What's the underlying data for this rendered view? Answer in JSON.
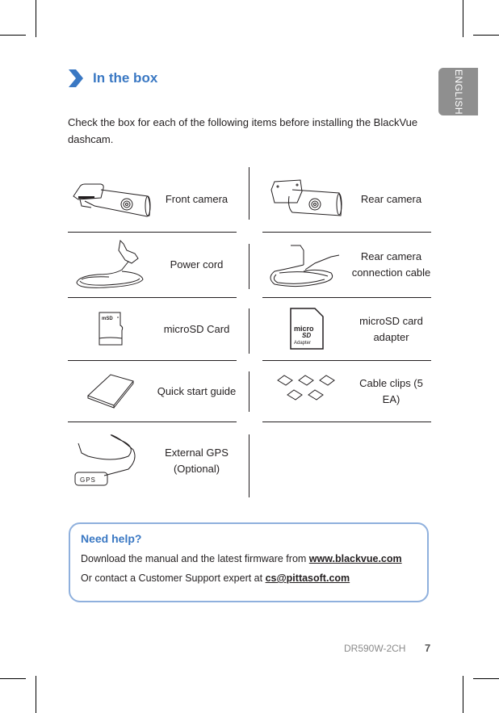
{
  "language_tab": "ENGLISH",
  "section": {
    "title": "In the box",
    "intro": "Check the box for each of the following items before installing the BlackVue dashcam."
  },
  "items": [
    {
      "label": "Front camera",
      "icon": "front-camera-icon"
    },
    {
      "label": "Rear camera",
      "icon": "rear-camera-icon"
    },
    {
      "label": "Power cord",
      "icon": "power-cord-icon"
    },
    {
      "label": "Rear camera connection cable",
      "icon": "connection-cable-icon"
    },
    {
      "label": "microSD Card",
      "icon": "microsd-card-icon"
    },
    {
      "label": "microSD card adapter",
      "icon": "sd-adapter-icon"
    },
    {
      "label": "Quick start guide",
      "icon": "quick-start-guide-icon"
    },
    {
      "label": "Cable clips (5 EA)",
      "icon": "cable-clips-icon"
    },
    {
      "label": "External GPS (Optional)",
      "icon": "external-gps-icon"
    }
  ],
  "icon_text": {
    "sd_adapter_micro": "micro",
    "sd_adapter_sd": "SD",
    "sd_adapter_adapter": "Adapter",
    "gps": "GPS"
  },
  "help": {
    "title": "Need help?",
    "line1_prefix": "Download the manual and the latest firmware from ",
    "line1_link": "www.blackvue.com",
    "line2_prefix": "Or contact a Customer Support expert at ",
    "line2_link": "cs@pittasoft.com"
  },
  "footer": {
    "model": "DR590W-2CH",
    "page": "7"
  },
  "colors": {
    "accent": "#3a78c3",
    "help_border": "#8fb0dd",
    "tab_gray": "#8f8f8f"
  }
}
